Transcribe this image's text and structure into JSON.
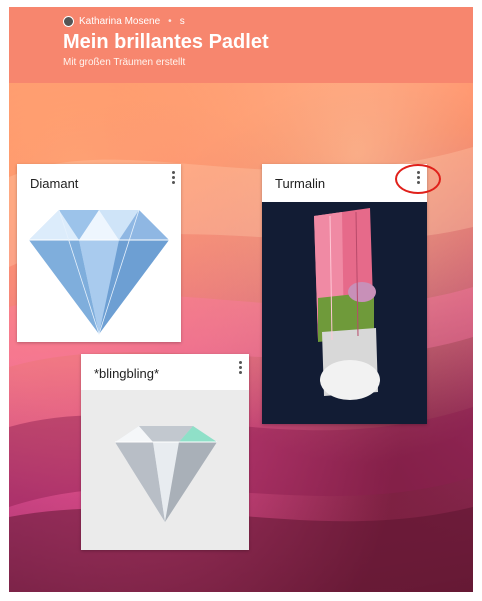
{
  "header": {
    "author": "Katharina Mosene",
    "meta": "s",
    "title": "Mein brillantes Padlet",
    "subtitle": "Mit großen Träumen erstellt"
  },
  "cards": [
    {
      "title": "Diamant",
      "image": "diamond-image"
    },
    {
      "title": "Turmalin",
      "image": "tourmaline-crystal-image"
    },
    {
      "title": "*blingbling*",
      "image": "diamond-photo-image"
    }
  ],
  "colors": {
    "header_bg": "#f7866e",
    "annotation": "#e0201a"
  },
  "icons": {
    "avatar": "avatar-icon",
    "menu": "more-vertical-icon"
  }
}
